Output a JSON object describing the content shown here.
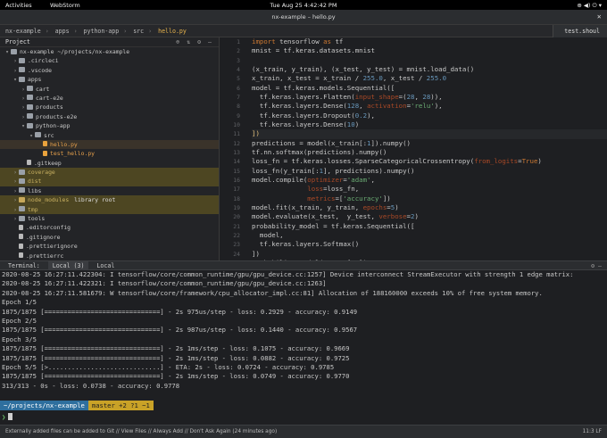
{
  "gnome": {
    "activities": "Activities",
    "app": "WebStorm",
    "clock": "Tue Aug 25   4:42:42 PM",
    "tray": "⊕ ◀) ⏻ ▾"
  },
  "window": {
    "title": "nx-example – hello.py",
    "close": "✕"
  },
  "breadcrumb": [
    "nx-example",
    "apps",
    "python-app",
    "src",
    "hello.py"
  ],
  "right_tab": "test.shoul",
  "project": {
    "title": "Project",
    "tree": [
      {
        "label": "nx-example ~/projects/nx-example",
        "depth": 0,
        "arrow": "▾",
        "icon": "folder"
      },
      {
        "label": ".circleci",
        "depth": 1,
        "arrow": "›",
        "icon": "folder"
      },
      {
        "label": ".vscode",
        "depth": 1,
        "arrow": "›",
        "icon": "folder"
      },
      {
        "label": "apps",
        "depth": 1,
        "arrow": "▾",
        "icon": "folder"
      },
      {
        "label": "cart",
        "depth": 2,
        "arrow": "›",
        "icon": "folder"
      },
      {
        "label": "cart-e2e",
        "depth": 2,
        "arrow": "›",
        "icon": "folder"
      },
      {
        "label": "products",
        "depth": 2,
        "arrow": "›",
        "icon": "folder"
      },
      {
        "label": "products-e2e",
        "depth": 2,
        "arrow": "›",
        "icon": "folder"
      },
      {
        "label": "python-app",
        "depth": 2,
        "arrow": "▾",
        "icon": "folder"
      },
      {
        "label": "src",
        "depth": 3,
        "arrow": "▾",
        "icon": "folder"
      },
      {
        "label": "hello.py",
        "depth": 4,
        "arrow": "",
        "icon": "py",
        "style": "sel",
        "color": "orange"
      },
      {
        "label": "test_hello.py",
        "depth": 4,
        "arrow": "",
        "icon": "py",
        "color": "orange"
      },
      {
        "label": ".gitkeep",
        "depth": 2,
        "arrow": "",
        "icon": "file"
      },
      {
        "label": "coverage",
        "depth": 1,
        "arrow": "›",
        "icon": "folder",
        "style": "hl",
        "color": "yellow"
      },
      {
        "label": "dist",
        "depth": 1,
        "arrow": "›",
        "icon": "folder",
        "style": "hl",
        "color": "yellow"
      },
      {
        "label": "libs",
        "depth": 1,
        "arrow": "›",
        "icon": "folder"
      },
      {
        "label": "node_modules",
        "depth": 1,
        "arrow": "›",
        "icon": "lib",
        "style": "hl",
        "color": "yellow",
        "suffix": "library root"
      },
      {
        "label": "tmp",
        "depth": 1,
        "arrow": "›",
        "icon": "folder",
        "style": "hl",
        "color": "yellow"
      },
      {
        "label": "tools",
        "depth": 1,
        "arrow": "›",
        "icon": "folder"
      },
      {
        "label": ".editorconfig",
        "depth": 1,
        "arrow": "",
        "icon": "file"
      },
      {
        "label": ".gitignore",
        "depth": 1,
        "arrow": "",
        "icon": "file"
      },
      {
        "label": ".prettierignore",
        "depth": 1,
        "arrow": "",
        "icon": "file"
      },
      {
        "label": ".prettierrc",
        "depth": 1,
        "arrow": "",
        "icon": "file"
      },
      {
        "label": "angular.json",
        "depth": 1,
        "arrow": "",
        "icon": "file"
      }
    ]
  },
  "editor": {
    "lines": [
      "<k>import</k> tensorflow <k>as</k> tf",
      "mnist = tf.keras.datasets.mnist",
      "",
      "(x_train, y_train), (x_test, y_test) = mnist.load_data()",
      "x_train, x_test = x_train / <n>255.0</n>, x_test / <n>255.0</n>",
      "model = tf.keras.models.Sequential([",
      "  tf.keras.layers.Flatten(<a>input_shape</a>=(<n>28</n>, <n>28</n>)),",
      "  tf.keras.layers.Dense(<n>128</n>, <a>activation</a>=<s>'relu'</s>),",
      "  tf.keras.layers.Dropout(<n>0.2</n>),",
      "  tf.keras.layers.Dense(<n>10</n>)",
      "<p>])</p>",
      "predictions = model(x_train[:<n>1</n>]).numpy()",
      "tf.nn.softmax(predictions).numpy()",
      "loss_fn = tf.keras.losses.SparseCategoricalCrossentropy(<a>from_logits</a>=<k>True</k>)",
      "loss_fn(y_train[:<n>1</n>], predictions).numpy()",
      "model.compile(<a>optimizer</a>=<s>'adam'</s>,",
      "              <a>loss</a>=loss_fn,",
      "              <a>metrics</a>=[<s>'accuracy'</s>])",
      "model.fit(x_train, y_train, <a>epochs</a>=<n>5</n>)",
      "model.evaluate(x_test,  y_test, <a>verbose</a>=<n>2</n>)",
      "probability_model = tf.keras.Sequential([",
      "  model,",
      "  tf.keras.layers.Softmax()",
      "])",
      "probability_model(x_test[:<n>5</n>])"
    ],
    "current_line": 11
  },
  "terminal_tabs": {
    "label": "Terminal:",
    "tabs": [
      "Local (3)",
      "Local"
    ],
    "tools": "⚙ –"
  },
  "terminal": {
    "lines": [
      "2020-08-25 16:27:11.422304: I tensorflow/core/common_runtime/gpu/gpu_device.cc:1257] Device interconnect StreamExecutor with strength 1 edge matrix:",
      "2020-08-25 16:27:11.422321: I tensorflow/core/common_runtime/gpu/gpu_device.cc:1263]",
      "2020-08-25 16:27:11.581679: W tensorflow/core/framework/cpu_allocator_impl.cc:81] Allocation of 188160000 exceeds 10% of free system memory.",
      "Epoch 1/5",
      "1875/1875 [==============================] - 2s 975us/step - loss: 0.2929 - accuracy: 0.9149",
      "Epoch 2/5",
      "1875/1875 [==============================] - 2s 987us/step - loss: 0.1440 - accuracy: 0.9567",
      "Epoch 3/5",
      "1875/1875 [==============================] - 2s 1ms/step - loss: 0.1075 - accuracy: 0.9669",
      "1875/1875 [==============================] - 2s 1ms/step - loss: 0.0882 - accuracy: 0.9725",
      "Epoch 5/5 [>.............................] - ETA: 2s - loss: 0.0724 - accuracy: 0.9785",
      "1875/1875 [==============================] - 2s 1ms/step - loss: 0.0749 - accuracy: 0.9770",
      "313/313 - 0s - loss: 0.0738 - accuracy: 0.9778"
    ],
    "prompt_path": "~/projects/nx-example",
    "prompt_git": "master +2 ?1 ~1",
    "prompt_symbol": "❯"
  },
  "status_bar": {
    "message": "Externally added files can be added to Git // View Files // Always Add // Don't Ask Again (24 minutes ago)",
    "right": "11:3  LF"
  }
}
